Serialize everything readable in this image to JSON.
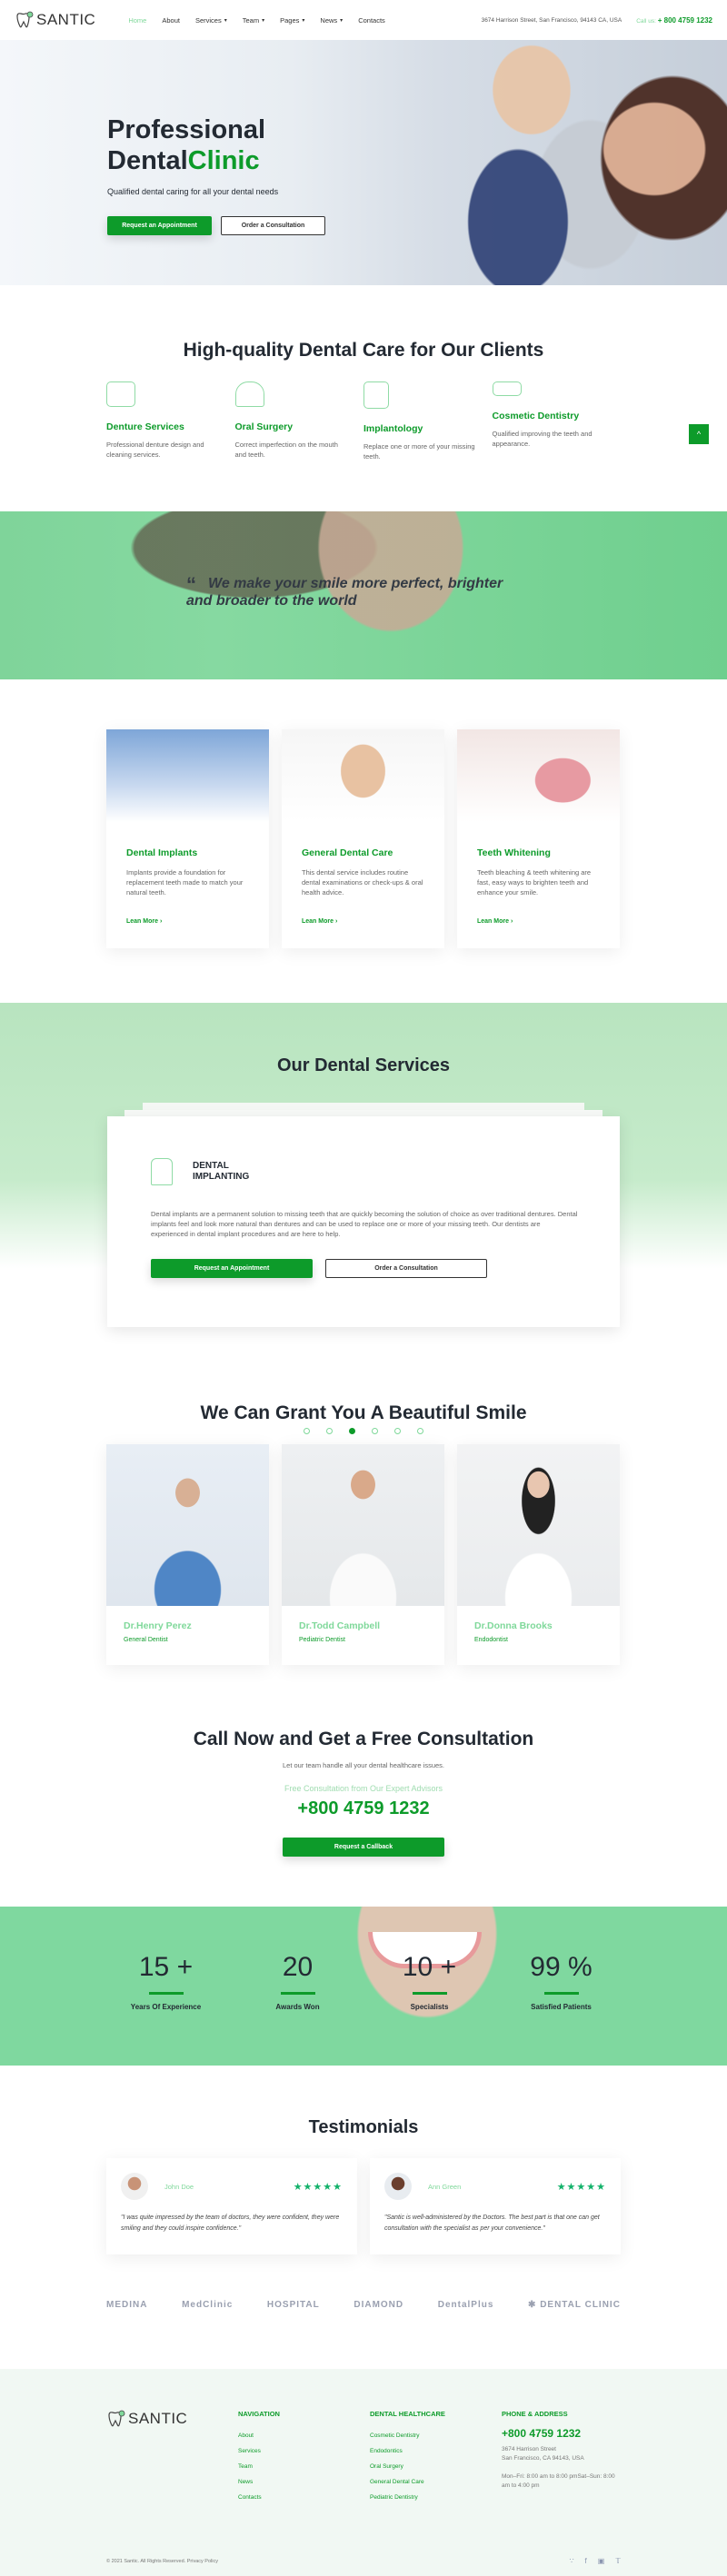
{
  "header": {
    "logo": "SANTIC",
    "nav": [
      {
        "label": "Home",
        "active": true,
        "dropdown": false
      },
      {
        "label": "About",
        "dropdown": false
      },
      {
        "label": "Services",
        "dropdown": true
      },
      {
        "label": "Team",
        "dropdown": true
      },
      {
        "label": "Pages",
        "dropdown": true
      },
      {
        "label": "News",
        "dropdown": true
      },
      {
        "label": "Contacts",
        "dropdown": false
      }
    ],
    "address": "3674 Harrison Street, San Francisco, 94143 CA, USA",
    "call_label": "Call us:",
    "call_number": "+ 800 4759 1232"
  },
  "hero": {
    "title_line1": "Professional",
    "title_line2_a": "Dental",
    "title_line2_b": "Clinic",
    "subtitle": "Qualified dental caring for all your dental needs",
    "primary_btn": "Request an Appointment",
    "secondary_btn": "Order a Consultation"
  },
  "features": {
    "title": "High-quality Dental Care for Our Clients",
    "items": [
      {
        "icon": "dentures-icon",
        "title": "Denture Services",
        "text": "Professional denture design and cleaning services."
      },
      {
        "icon": "oral-surgery-icon",
        "title": "Oral Surgery",
        "text": "Correct imperfection on the mouth and teeth."
      },
      {
        "icon": "implant-icon",
        "title": "Implantology",
        "text": "Replace one or more of your missing teeth."
      },
      {
        "icon": "braces-icon",
        "title": "Cosmetic Dentistry",
        "text": "Qualified improving the teeth and appearance."
      }
    ],
    "to_top": "^"
  },
  "quote": {
    "mark": "“",
    "text": "We make your smile more perfect, brighter and broader to the world"
  },
  "services": [
    {
      "title": "Dental Implants",
      "text": "Implants provide a foundation for replacement teeth made to match your natural teeth.",
      "link": "Lean More ›"
    },
    {
      "title": "General Dental Care",
      "text": "This dental service includes routine dental examinations or check-ups & oral health advice.",
      "link": "Lean More ›"
    },
    {
      "title": "Teeth Whitening",
      "text": "Teeth bleaching & teeth whitening are fast, easy ways to brighten teeth and enhance your smile.",
      "link": "Lean More ›"
    }
  ],
  "ods": {
    "title": "Our Dental Services",
    "slide_title": "DENTAL IMPLANTING",
    "slide_text": "Dental implants are a permanent solution to missing teeth that are quickly becoming the solution of choice as over traditional dentures. Dental implants feel and look more natural than dentures and can be used to replace one or more of your missing teeth. Our dentists are experienced in dental implant procedures and are here to help.",
    "primary_btn": "Request an Appointment",
    "secondary_btn": "Order a Consultation",
    "dots": 6,
    "active_dot": 3
  },
  "team": {
    "title": "We Can Grant You A Beautiful Smile",
    "members": [
      {
        "name": "Dr.Henry Perez",
        "role": "General Dentist"
      },
      {
        "name": "Dr.Todd Campbell",
        "role": "Pediatric Dentist"
      },
      {
        "name": "Dr.Donna Brooks",
        "role": "Endodontist"
      }
    ]
  },
  "consult": {
    "title": "Call Now and Get a Free Consultation",
    "subtitle": "Let our team handle all your dental healthcare issues.",
    "label": "Free Consultation from Our Expert Advisors",
    "phone": "+800 4759 1232",
    "button": "Request a Callback"
  },
  "stats": [
    {
      "value": "15 +",
      "label": "Years Of Experience"
    },
    {
      "value": "20",
      "label": "Awards Won"
    },
    {
      "value": "10 +",
      "label": "Specialists"
    },
    {
      "value": "99 %",
      "label": "Satisfied Patients"
    }
  ],
  "testimonials": {
    "title": "Testimonials",
    "items": [
      {
        "name": "John Doe",
        "rating": 5,
        "stars": "★★★★★",
        "text": "\"I was quite impressed by the team of doctors, they were confident, they were smiling and they could inspire confidence.\""
      },
      {
        "name": "Ann Green",
        "rating": 5,
        "stars": "★★★★★",
        "text": "\"Santic is well-administered by the Doctors. The best part is that one can get consultation with the specialist as per your convenience.\""
      }
    ]
  },
  "partners": [
    "MEDINA",
    "MedClinic",
    "HOSPITAL",
    "DIAMOND",
    "DentalPlus",
    "✱ DENTAL CLINIC"
  ],
  "footer": {
    "logo": "SANTIC",
    "nav_title": "NAVIGATION",
    "nav": [
      "About",
      "Services",
      "Team",
      "News",
      "Contacts"
    ],
    "health_title": "DENTAL HEALTHCARE",
    "health": [
      "Cosmetic Dentistry",
      "Endodontics",
      "Oral Surgery",
      "General Dental Care",
      "Pediatric Dentistry"
    ],
    "contact_title": "PHONE & ADDRESS",
    "phone": "+800 4759 1232",
    "address1": "3674 Harrison Street",
    "address2": "San Francisco, CA 94143, USA",
    "hours": "Mon–Fri: 8:00 am to 8:00 pmSat–Sun: 8:00 am to 4:00 pm",
    "copyright": "© 2021 Santic. All Rights Reserved. Privacy Policy",
    "social": [
      "rss-icon",
      "facebook-icon",
      "instagram-icon",
      "twitter-icon"
    ]
  },
  "colors": {
    "accent": "#0d9b2a",
    "light_accent": "#7fd89a",
    "text": "#232a33"
  }
}
